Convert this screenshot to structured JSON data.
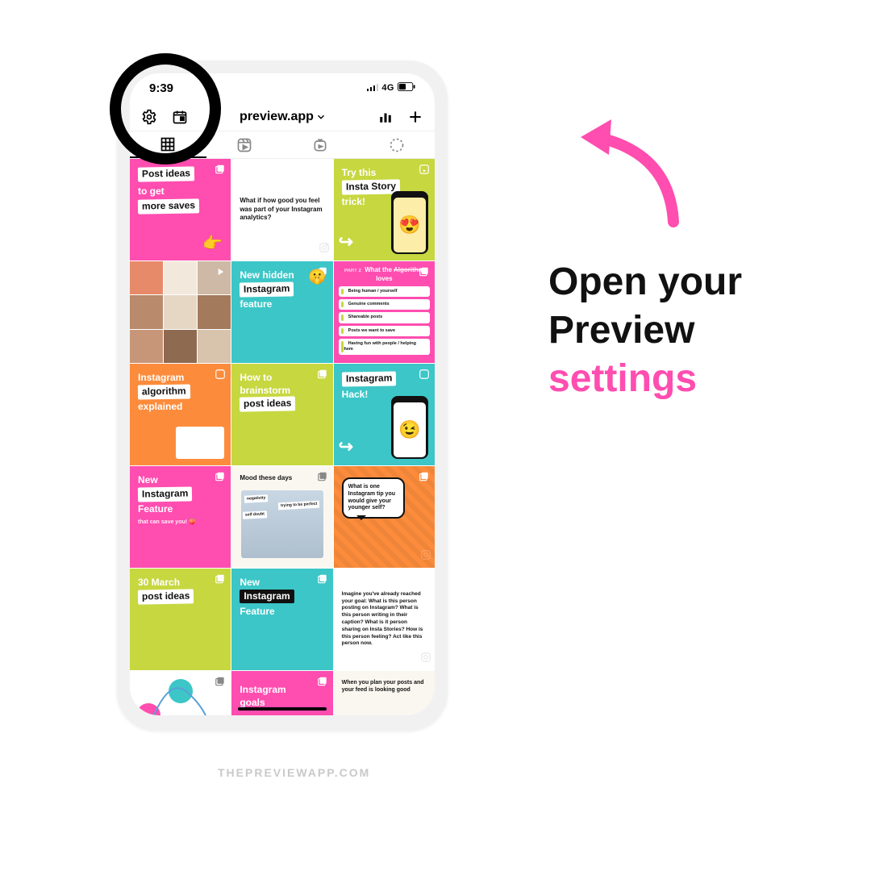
{
  "status": {
    "time": "9:39",
    "network": "4G"
  },
  "toolbar": {
    "title": "preview.app"
  },
  "caption": {
    "line1": "Open your",
    "line2": "Preview",
    "line3": "settings"
  },
  "watermark": "THEPREVIEWAPP.COM",
  "tiles": {
    "t0": {
      "a": "Post ideas",
      "b": "to get",
      "c": "more saves"
    },
    "t1": {
      "text": "What if how good you feel was part of your Instagram analytics?"
    },
    "t2": {
      "a": "Try this",
      "b": "Insta Story",
      "c": "trick!"
    },
    "t4": {
      "a": "New hidden",
      "b": "Instagram",
      "c": "feature"
    },
    "t5": {
      "hdr_a": "What the",
      "hdr_b": "Algorithm",
      "hdr_c": "loves",
      "r1": "Being human / yourself",
      "r2": "Genuine comments",
      "r3": "Shareable posts",
      "r4": "Posts we want to save",
      "r5": "Having fun with people / helping them"
    },
    "t6": {
      "a": "Instagram",
      "b": "algorithm",
      "c": "explained"
    },
    "t7": {
      "a": "How to",
      "b": "brainstorm",
      "c": "post ideas"
    },
    "t8": {
      "a": "Instagram",
      "b": "Hack!"
    },
    "t9": {
      "a": "New",
      "b": "Instagram",
      "c": "Feature",
      "d": "that can save you!"
    },
    "t10": {
      "title": "Mood these days",
      "c1": "negativity",
      "c2": "self doubt",
      "c3": "trying to be perfect"
    },
    "t11": {
      "text": "What is one Instagram tip you would give your younger self?"
    },
    "t12": {
      "a": "30 March",
      "b": "post ideas"
    },
    "t13": {
      "a": "New",
      "b": "Instagram",
      "c": "Feature"
    },
    "t14": {
      "text": "Imagine you've already reached your goal: What is this person posting on Instagram? What is this person writing in their caption? What is it person sharing on Insta Stories? How is this person feeling? Act like this person now."
    },
    "t16": {
      "a": "Instagram",
      "b": "goals"
    },
    "t17": {
      "text": "When you plan your posts and your feed is looking good"
    }
  }
}
